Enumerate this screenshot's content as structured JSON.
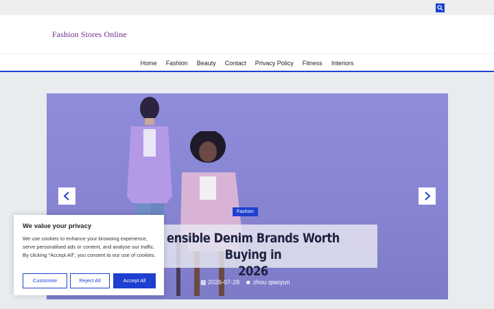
{
  "site": {
    "title": "Fashion Stores Online"
  },
  "nav": {
    "items": [
      "Home",
      "Fashion",
      "Beauty",
      "Contact",
      "Privacy Policy",
      "Fitness",
      "Interiors"
    ]
  },
  "slider": {
    "category": "Fashion",
    "title": "ensible Denim Brands Worth Buying in 2026",
    "title_line1": "ensible Denim Brands Worth Buying in",
    "title_line2": "2026",
    "date": "2026-07-28",
    "author": "zhou qiaoyun"
  },
  "cookie": {
    "heading": "We value your privacy",
    "body": "We use cookies to enhance your browsing experience, serve personalised ads or content, and analyse our traffic. By clicking \"Accept All\", you consent to our use of cookies.",
    "customise": "Customise",
    "reject": "Reject All",
    "accept": "Accept All"
  },
  "colors": {
    "accent": "#1e3fcf",
    "site_title": "#6a2c8c"
  }
}
